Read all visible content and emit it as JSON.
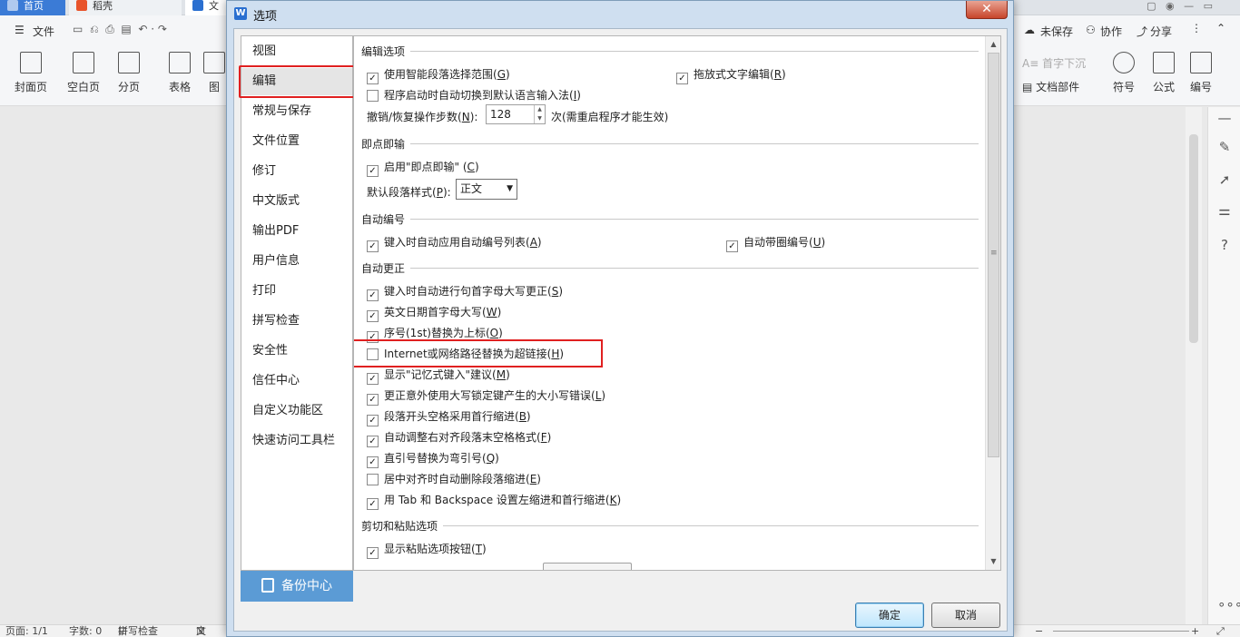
{
  "background": {
    "tabs": [
      {
        "label": "首页"
      },
      {
        "label": "稻壳"
      },
      {
        "label": "文"
      }
    ],
    "toolbar1": {
      "file_menu": "文件",
      "unsaved": "未保存",
      "collab": "协作",
      "share": "分享"
    },
    "ribbon": {
      "left_buttons": [
        {
          "label": "封面页"
        },
        {
          "label": "空白页"
        },
        {
          "label": "分页"
        },
        {
          "label": "表格"
        },
        {
          "label": "图"
        }
      ],
      "right_top": "首字下沉",
      "doc_parts": "文档部件",
      "right_buttons": [
        {
          "label": "符号"
        },
        {
          "label": "公式"
        },
        {
          "label": "编号"
        }
      ]
    },
    "statusbar": {
      "page": "页面: 1/1",
      "words": "字数: 0",
      "spell": "拼写检查",
      "doc": "文"
    }
  },
  "dialog": {
    "title": "选项",
    "icon_letter": "W",
    "nav": [
      {
        "label": "视图"
      },
      {
        "label": "编辑"
      },
      {
        "label": "常规与保存"
      },
      {
        "label": "文件位置"
      },
      {
        "label": "修订"
      },
      {
        "label": "中文版式"
      },
      {
        "label": "输出PDF"
      },
      {
        "label": "用户信息"
      },
      {
        "label": "打印"
      },
      {
        "label": "拼写检查"
      },
      {
        "label": "安全性"
      },
      {
        "label": "信任中心"
      },
      {
        "label": "自定义功能区"
      },
      {
        "label": "快速访问工具栏"
      }
    ],
    "active_nav": "编辑",
    "backup_center": "备份中心",
    "sections": {
      "edit_options": {
        "title": "编辑选项",
        "smart_select": {
          "label": "使用智能段落选择范围(",
          "key": "G",
          "end": ")",
          "checked": true
        },
        "drag_drop": {
          "label": "拖放式文字编辑(",
          "key": "R",
          "end": ")",
          "checked": true
        },
        "auto_ime": {
          "label": "程序启动时自动切换到默认语言输入法(",
          "key": "I",
          "end": ")",
          "checked": false
        },
        "undo_label": "撤销/恢复操作步数(",
        "undo_key": "N",
        "undo_end": "):",
        "undo_value": "128",
        "undo_note": "次(需重启程序才能生效)"
      },
      "click_type": {
        "title": "即点即输",
        "enable": {
          "label": "启用\"即点即输\" (",
          "key": "C",
          "end": ")",
          "checked": true
        },
        "default_para_label": "默认段落样式(",
        "default_para_key": "P",
        "default_para_end": "):",
        "default_para_value": "正文"
      },
      "auto_number": {
        "title": "自动编号",
        "auto_list": {
          "label": "键入时自动应用自动编号列表(",
          "key": "A",
          "end": ")",
          "checked": true
        },
        "auto_circle": {
          "label": "自动带圈编号(",
          "key": "U",
          "end": ")",
          "checked": true
        }
      },
      "auto_correct": {
        "title": "自动更正",
        "items": [
          {
            "label": "键入时自动进行句首字母大写更正(",
            "key": "S",
            "end": ")",
            "checked": true
          },
          {
            "label": "英文日期首字母大写(",
            "key": "W",
            "end": ")",
            "checked": true
          },
          {
            "label": "序号(1st)替换为上标(",
            "key": "O",
            "end": ")",
            "checked": true
          },
          {
            "label": "Internet或网络路径替换为超链接(",
            "key": "H",
            "end": ")",
            "checked": false
          },
          {
            "label": "显示\"记忆式键入\"建议(",
            "key": "M",
            "end": ")",
            "checked": true
          },
          {
            "label": "更正意外使用大写锁定键产生的大小写错误(",
            "key": "L",
            "end": ")",
            "checked": true
          },
          {
            "label": "段落开头空格采用首行缩进(",
            "key": "B",
            "end": ")",
            "checked": true
          },
          {
            "label": "自动调整右对齐段落末空格格式(",
            "key": "F",
            "end": ")",
            "checked": true
          },
          {
            "label": "直引号替换为弯引号(",
            "key": "Q",
            "end": ")",
            "checked": true
          },
          {
            "label": "居中对齐时自动删除段落缩进(",
            "key": "E",
            "end": ")",
            "checked": false
          },
          {
            "label": "用 Tab 和 Backspace 设置左缩进和首行缩进(",
            "key": "K",
            "end": ")",
            "checked": true
          }
        ]
      },
      "paste": {
        "title": "剪切和粘贴选项",
        "show_paste_btn": {
          "label": "显示粘贴选项按钮(",
          "key": "T",
          "end": ")",
          "checked": true
        }
      }
    },
    "buttons": {
      "ok": "确定",
      "cancel": "取消"
    },
    "colors": {
      "highlight_box": "#e02020",
      "backup_bg": "#5b9bd5",
      "dialog_frame": "#cfdff0"
    }
  }
}
